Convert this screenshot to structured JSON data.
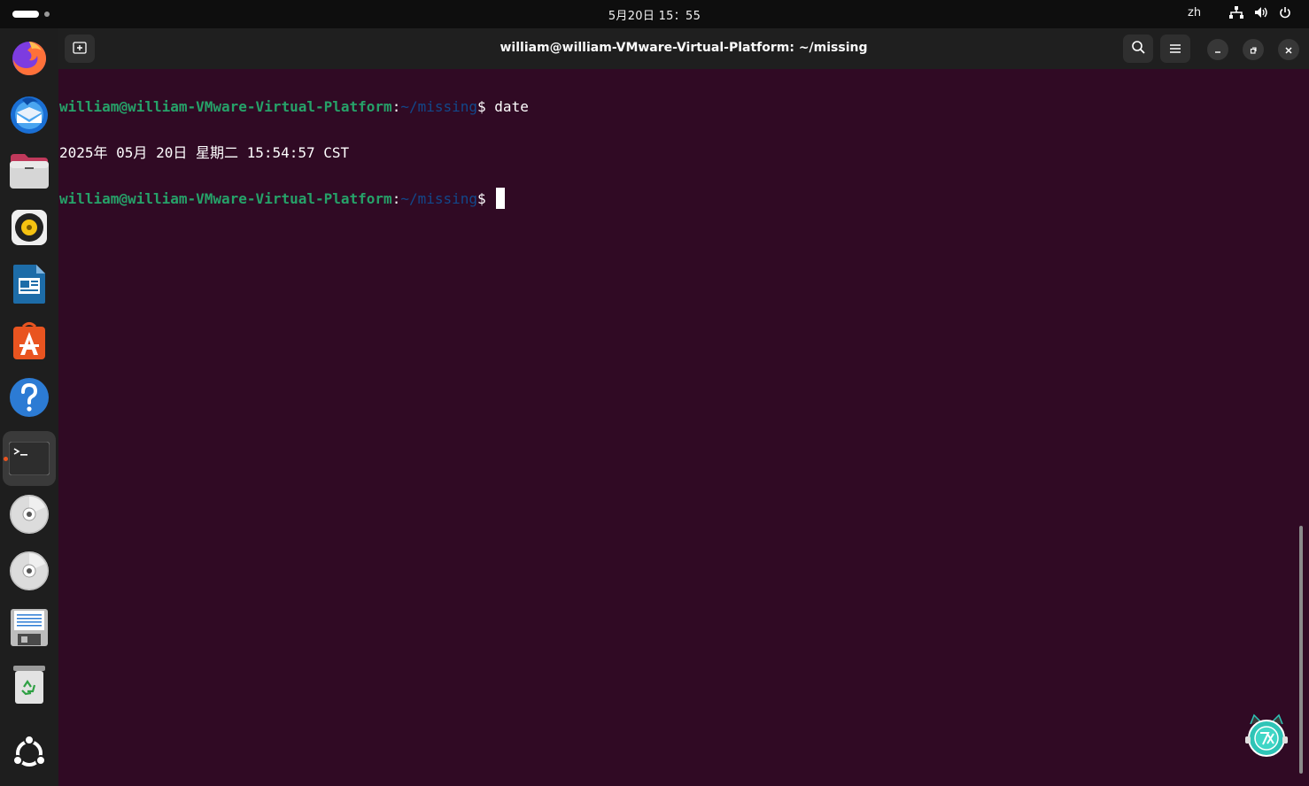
{
  "topbar": {
    "clock": "5月20日 15：55",
    "language": "zh"
  },
  "dock": {
    "items": [
      {
        "name": "firefox-icon"
      },
      {
        "name": "thunderbird-icon"
      },
      {
        "name": "files-icon"
      },
      {
        "name": "rhythmbox-icon"
      },
      {
        "name": "writer-icon"
      },
      {
        "name": "app-center-icon"
      },
      {
        "name": "help-icon"
      },
      {
        "name": "terminal-icon",
        "active": true
      },
      {
        "name": "disc-icon"
      },
      {
        "name": "disc-icon"
      },
      {
        "name": "floppy-icon"
      },
      {
        "name": "trash-icon"
      },
      {
        "name": "ubuntu-logo-icon"
      }
    ]
  },
  "window": {
    "title": "william@william-VMware-Virtual-Platform: ~/missing"
  },
  "terminal": {
    "lines": [
      {
        "user": "william@william-VMware-Virtual-Platform",
        "sep": ":",
        "path": "~/missing",
        "prompt": "$ ",
        "cmd": "date"
      },
      {
        "output": "2025年 05月 20日 星期二 15:54:57 CST"
      },
      {
        "user": "william@william-VMware-Virtual-Platform",
        "sep": ":",
        "path": "~/missing",
        "prompt": "$ ",
        "cmd": ""
      }
    ]
  },
  "colors": {
    "terminal_bg": "#300a24",
    "prompt_user": "#26a269",
    "prompt_path": "#12488b",
    "accent": "#e95420"
  }
}
